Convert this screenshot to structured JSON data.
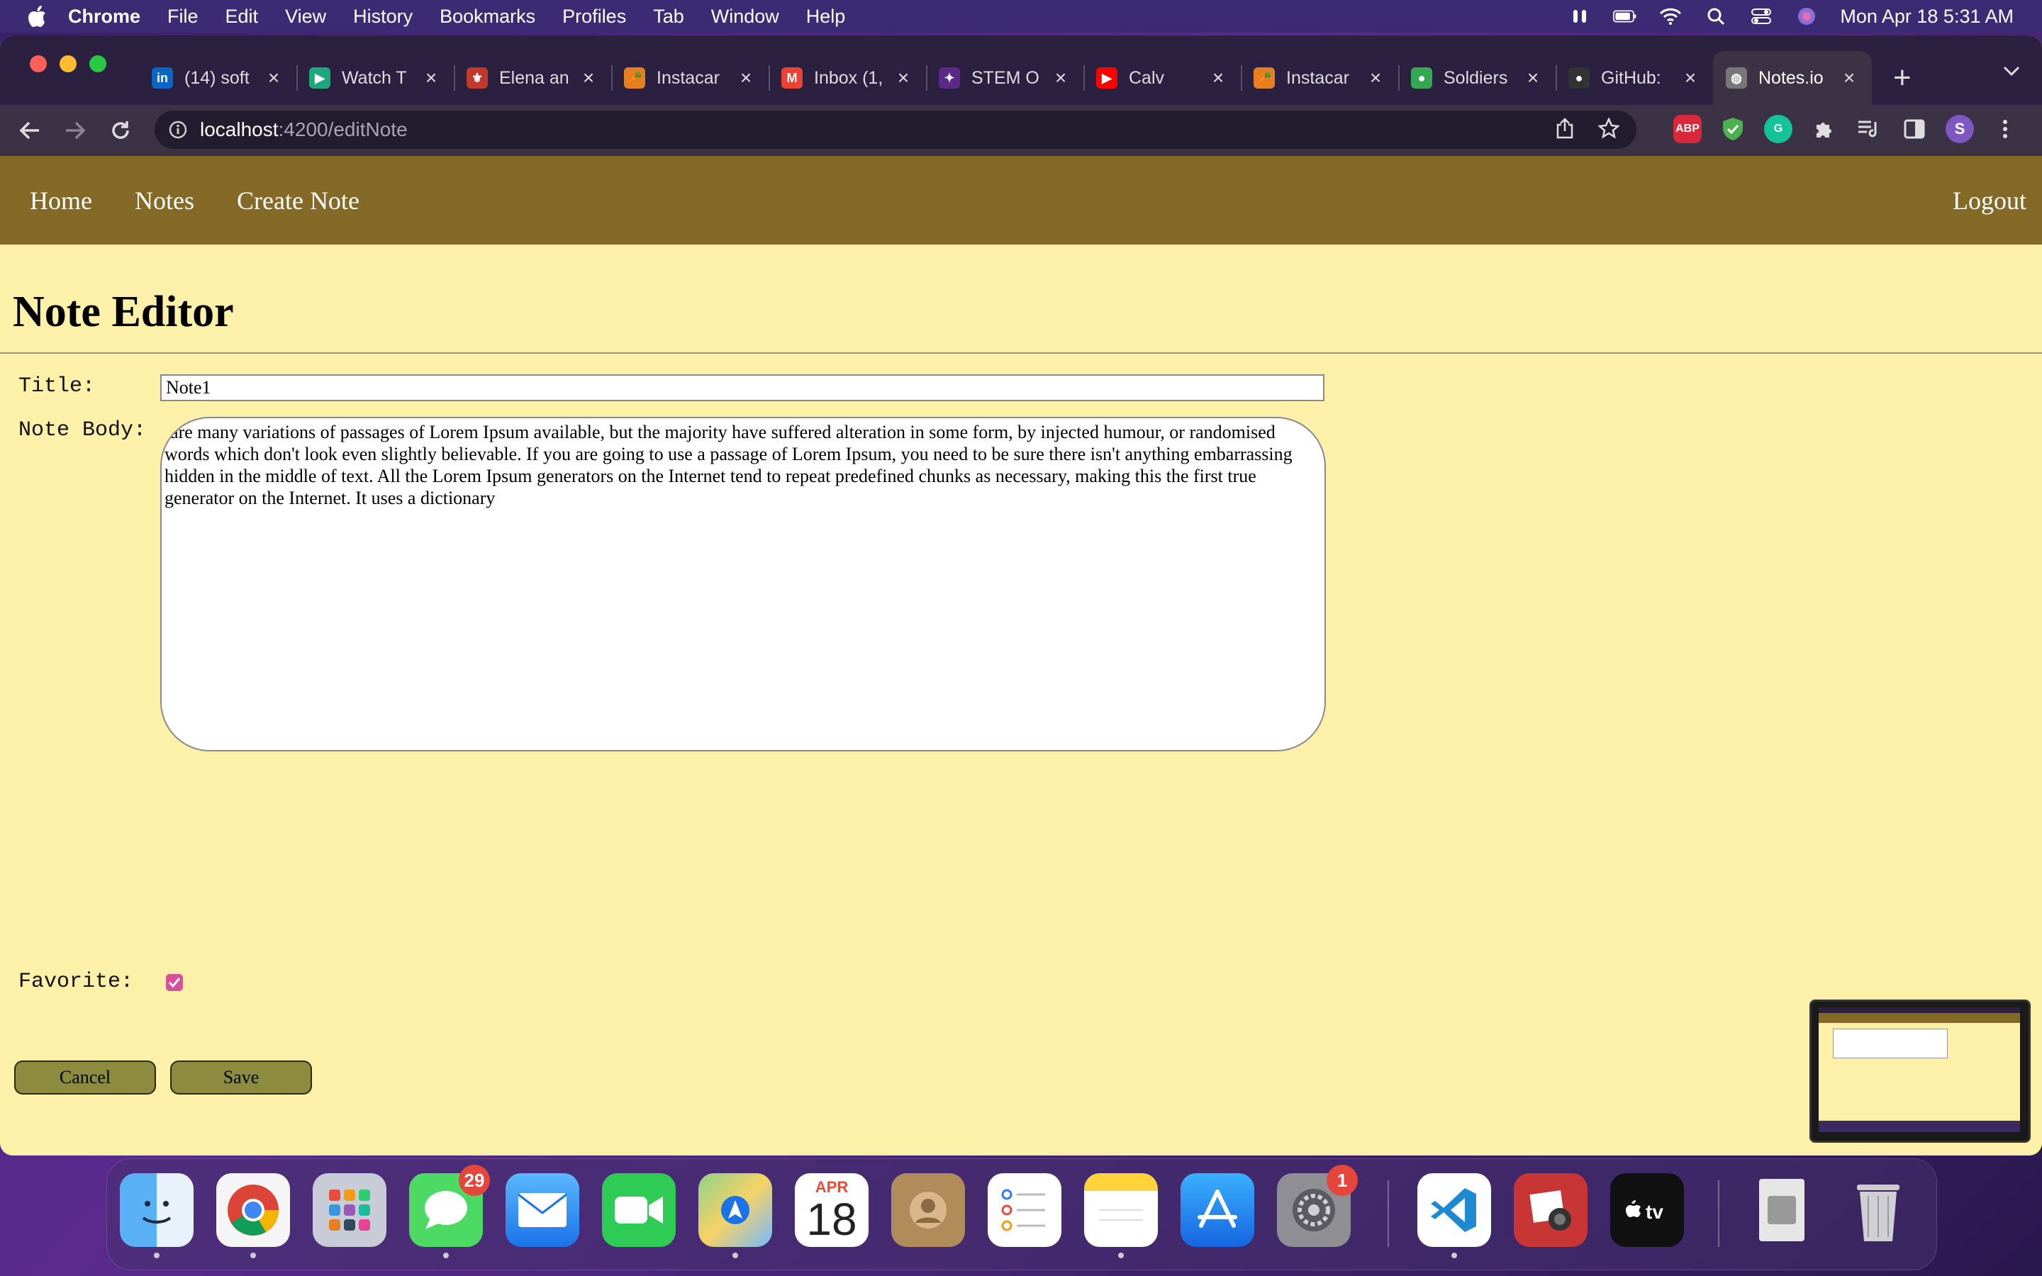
{
  "menubar": {
    "app_name": "Chrome",
    "items": [
      "File",
      "Edit",
      "View",
      "History",
      "Bookmarks",
      "Profiles",
      "Tab",
      "Window",
      "Help"
    ],
    "clock": "Mon Apr 18  5:31 AM"
  },
  "tabs": [
    {
      "title": "(14) soft",
      "icon": "linkedin-icon",
      "color": "#0a66c2",
      "glyph": "in"
    },
    {
      "title": "Watch T",
      "icon": "play-icon",
      "color": "#1fa67a",
      "glyph": "▶"
    },
    {
      "title": "Elena an",
      "icon": "fleur-icon",
      "color": "#c0392b",
      "glyph": "⚜"
    },
    {
      "title": "Instacar",
      "icon": "carrot-icon",
      "color": "#e67e22",
      "glyph": "🥕"
    },
    {
      "title": "Inbox (1,",
      "icon": "gmail-icon",
      "color": "#ea4335",
      "glyph": "M"
    },
    {
      "title": "STEM O",
      "icon": "stem-icon",
      "color": "#5b2a86",
      "glyph": "✦"
    },
    {
      "title": "Calv",
      "icon": "youtube-icon",
      "color": "#ff0000",
      "glyph": "▶"
    },
    {
      "title": "Instacar",
      "icon": "carrot-icon",
      "color": "#e67e22",
      "glyph": "🥕"
    },
    {
      "title": "Soldiers",
      "icon": "maps-pin-icon",
      "color": "#34a853",
      "glyph": "●"
    },
    {
      "title": "GitHub:",
      "icon": "github-icon",
      "color": "#333333",
      "glyph": "●"
    },
    {
      "title": "Notes.io",
      "icon": "globe-icon",
      "color": "#777777",
      "glyph": "◍",
      "active": true
    }
  ],
  "address": {
    "host": "localhost",
    "path": ":4200/editNote"
  },
  "nav": {
    "home": "Home",
    "notes": "Notes",
    "create": "Create Note",
    "logout": "Logout"
  },
  "editor": {
    "heading": "Note Editor",
    "title_label": "Title:",
    "title_value": "Note1",
    "body_label": "Note Body:",
    "body_value": "e are many variations of passages of Lorem Ipsum available, but the majority have suffered alteration in some form, by injected humour, or randomised words which don't look even slightly believable. If you are going to use a passage of Lorem Ipsum, you need to be sure there isn't anything embarrassing hidden in the middle of text. All the Lorem Ipsum generators on the Internet tend to repeat predefined chunks as necessary, making this the first true generator on the Internet. It uses a dictionary",
    "favorite_label": "Favorite:",
    "favorite_checked": true,
    "cancel_label": "Cancel",
    "save_label": "Save"
  },
  "colors": {
    "navbar": "#856a27",
    "page_bg": "#fdf0a8",
    "button": "#8d8b3e",
    "checkbox": "#d8509c"
  },
  "dock": {
    "messages_badge": "29",
    "settings_badge": "1",
    "calendar_month": "APR",
    "calendar_day": "18"
  }
}
